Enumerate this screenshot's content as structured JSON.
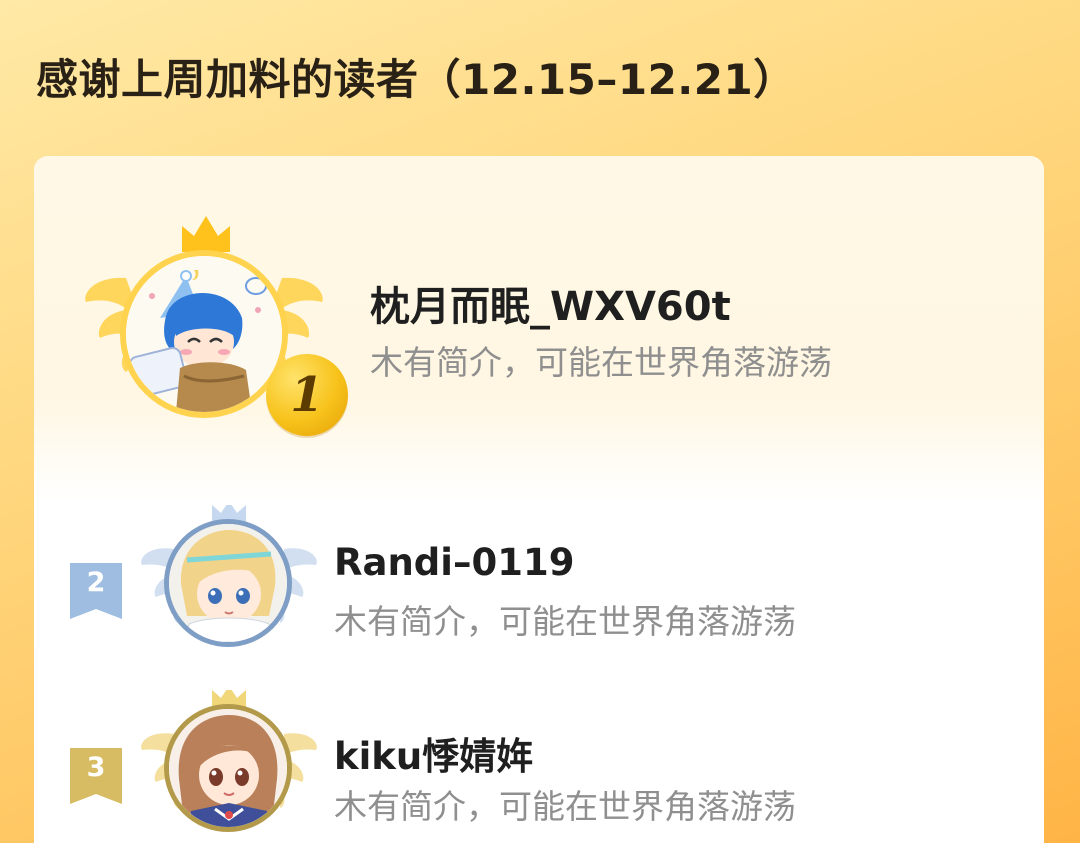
{
  "header": {
    "title": "感谢上周加料的读者（12.15–12.21）"
  },
  "leaderboard": {
    "entries": [
      {
        "rank": "1",
        "name": "枕月而眠_WXV60t",
        "bio": "木有简介，可能在世界角落游荡",
        "avatar": "avatar-blue-hair-sleepy-icon"
      },
      {
        "rank": "2",
        "name": "Randi–0119",
        "bio": "木有简介，可能在世界角落游荡",
        "avatar": "avatar-blonde-anime-icon"
      },
      {
        "rank": "3",
        "name": "kiku悸婧姩",
        "bio": "木有简介，可能在世界角落游荡",
        "avatar": "avatar-brown-hair-anime-icon"
      }
    ]
  },
  "colors": {
    "background_gradient_start": "#ffe9a6",
    "background_gradient_end": "#ffb446",
    "gold": "#f7c21a",
    "silver": "#8eb2d8",
    "bronze": "#d9b64a"
  }
}
